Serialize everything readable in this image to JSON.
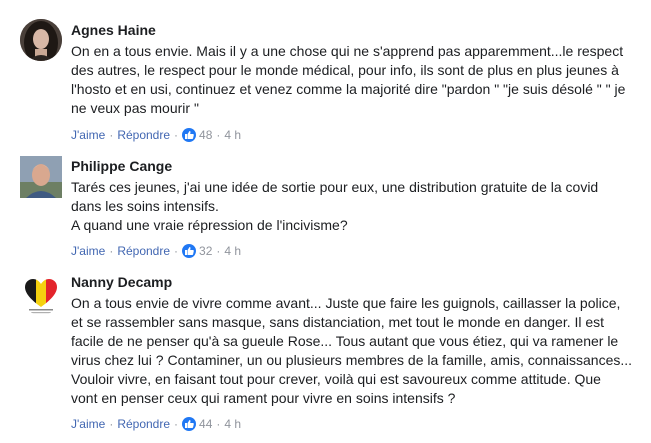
{
  "comments": [
    {
      "author": "Agnes Haine",
      "text": "On en a tous envie. Mais il y a une chose qui ne s'apprend pas apparemment...le respect\ndes autres, le respect pour le monde médical, pour info, ils sont de plus en plus jeunes à\nl'hosto et en usi, continuez et venez comme la majorité dire \"pardon \" \"je suis désolé \" \" je\nne veux pas mourir \"",
      "like_label": "J'aime",
      "reply_label": "Répondre",
      "reactions": "48",
      "time": "4 h"
    },
    {
      "author": "Philippe Cange",
      "text": "Tarés ces jeunes, j'ai une idée de sortie pour eux, une distribution gratuite de la covid\ndans les soins intensifs.\nA quand une vraie répression de l'incivisme?",
      "like_label": "J'aime",
      "reply_label": "Répondre",
      "reactions": "32",
      "time": "4 h"
    },
    {
      "author": "Nanny Decamp",
      "text": "On a tous envie de vivre comme avant... Juste que faire les guignols, caillasser la police,\net se rassembler sans masque, sans distanciation, met tout le monde en danger. Il est\nfacile de ne penser qu'à sa gueule Rose... Tous autant que vous étiez, qui va ramener le\nvirus chez lui ? Contaminer, un ou plusieurs membres de la famille, amis, connaissances...\nVouloir vivre, en faisant tout pour crever, voilà qui est savoureux comme attitude. Que\nvont en penser ceux qui rament pour vivre en soins intensifs ?",
      "like_label": "J'aime",
      "reply_label": "Répondre",
      "reactions": "44",
      "time": "4 h"
    }
  ],
  "colors": {
    "link": "#4267b2",
    "meta": "#90949c",
    "text": "#1c1e21",
    "like_badge": "#2078f4"
  }
}
